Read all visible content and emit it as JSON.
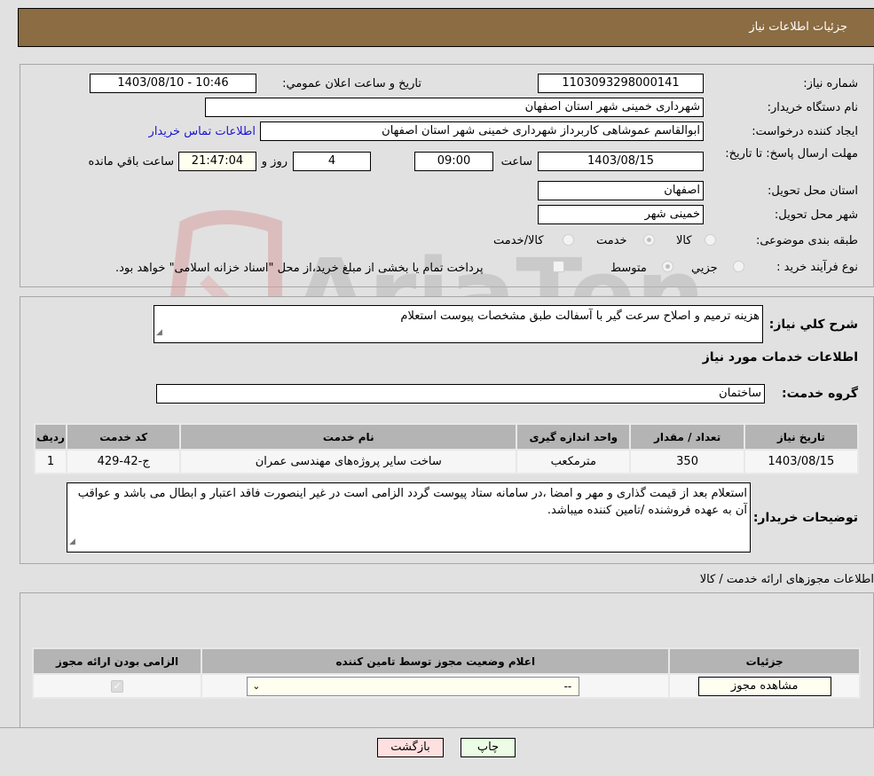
{
  "header": {
    "title": "جزئیات اطلاعات نیاز"
  },
  "fields": {
    "need_number": {
      "label": "شماره نیاز:",
      "value": "1103093298000141"
    },
    "announce_datetime": {
      "label": "تاریخ و ساعت اعلان عمومي:",
      "value": "1403/08/10 - 10:46"
    },
    "buyer_org": {
      "label": "نام دستگاه خریدار:",
      "value": "شهرداری خمینی شهر استان اصفهان"
    },
    "requester": {
      "label": "ایجاد کننده درخواست:",
      "value": "ابوالقاسم عموشاهی کاربرداز شهرداری خمینی شهر استان اصفهان"
    },
    "buyer_contact_link": "اطلاعات تماس خریدار",
    "deadline": {
      "label": "مهلت ارسال پاسخ: تا تاریخ:",
      "date": "1403/08/15",
      "time_label": "ساعت",
      "time": "09:00",
      "days": "4",
      "days_label": "روز و",
      "remaining": "21:47:04",
      "remaining_label": "ساعت باقي مانده"
    },
    "province": {
      "label": "استان محل تحویل:",
      "value": "اصفهان"
    },
    "city": {
      "label": "شهر محل تحویل:",
      "value": "خمینی شهر"
    },
    "category": {
      "label": "طبقه بندی موضوعی:",
      "options": [
        "کالا",
        "خدمت",
        "کالا/خدمت"
      ],
      "selected": "خدمت"
    },
    "purchase_type": {
      "label": "نوع فرآیند خرید :",
      "options": [
        "جزيي",
        "متوسط"
      ],
      "selected": "متوسط",
      "treasury_note": "پرداخت تمام یا بخشی از مبلغ خرید،از محل \"اسناد خزانه اسلامی\" خواهد بود."
    }
  },
  "description": {
    "label": "شرح کلي نیاز:",
    "value": "هزینه ترمیم و اصلاح سرعت گیر با آسفالت طبق مشخصات پیوست استعلام"
  },
  "services_section": {
    "title": "اطلاعات خدمات مورد نیاز"
  },
  "service_group": {
    "label": "گروه خدمت:",
    "value": "ساختمان"
  },
  "services_table": {
    "headers": [
      "ردیف",
      "کد خدمت",
      "نام خدمت",
      "واحد اندازه گیری",
      "تعداد / مقدار",
      "تاریخ نیاز"
    ],
    "rows": [
      [
        "1",
        "ج-42-429",
        "ساخت سایر پروژه‌های مهندسی عمران",
        "مترمکعب",
        "350",
        "1403/08/15"
      ]
    ]
  },
  "buyer_notes": {
    "label": "توضیحات خریدار:",
    "value": "استعلام بعد از قیمت گذاری و مهر و امضا ،در سامانه ستاد پیوست گردد الزامی است در غیر اینصورت فاقد اعتبار و ابطال می باشد و عواقب آن به عهده فروشنده /تامین کننده میباشد."
  },
  "permits_section": {
    "title": "اطلاعات مجوزهای ارائه خدمت / کالا"
  },
  "permits_table": {
    "headers": [
      "الزامی بودن ارائه مجوز",
      "اعلام وضعیت مجوز توسط تامین کننده",
      "جزئیات"
    ],
    "rows": [
      {
        "required": true,
        "status": "--",
        "details_button": "مشاهده مجوز"
      }
    ]
  },
  "actions": {
    "print": "چاپ",
    "back": "بازگشت"
  },
  "watermark": "AriaTender.neT"
}
